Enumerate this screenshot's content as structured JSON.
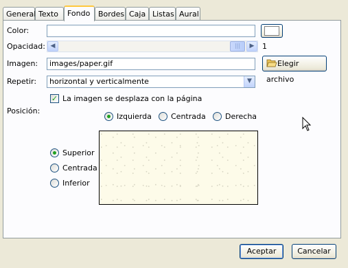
{
  "tabs": [
    "General",
    "Texto",
    "Fondo",
    "Bordes",
    "Caja",
    "Listas",
    "Aural"
  ],
  "active_tab": "Fondo",
  "color": {
    "label": "Color:",
    "value": ""
  },
  "opacity": {
    "label": "Opacidad:",
    "value": "1"
  },
  "image": {
    "label": "Imagen:",
    "value": "images/paper.gif",
    "button": "Elegir archivo",
    "button_icon": "folder-open-icon"
  },
  "repeat": {
    "label": "Repetir:",
    "value": "horizontal y verticalmente"
  },
  "scroll_checkbox": {
    "label": "La imagen se desplaza con la página",
    "checked": true
  },
  "position": {
    "label": "Posición:",
    "horizontal": [
      {
        "label": "Izquierda",
        "selected": true
      },
      {
        "label": "Centrada",
        "selected": false
      },
      {
        "label": "Derecha",
        "selected": false
      }
    ],
    "vertical": [
      {
        "label": "Superior",
        "selected": true
      },
      {
        "label": "Centrada",
        "selected": false
      },
      {
        "label": "Inferior",
        "selected": false
      }
    ]
  },
  "buttons": {
    "accept": "Aceptar",
    "cancel": "Cancelar"
  },
  "colors": {
    "tab_accent": "#ffc83c",
    "radio_check": "#21a121",
    "preview_bg": "#fdfbe9"
  }
}
